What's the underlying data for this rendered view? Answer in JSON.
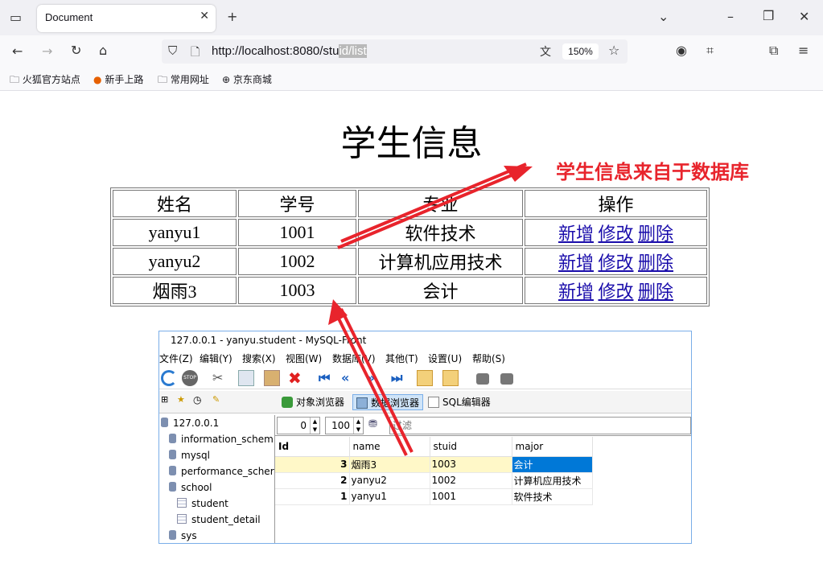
{
  "browser": {
    "tab_title": "Document",
    "url_prefix": "http://localhost:8080/stu",
    "url_selected": "id/list",
    "zoom": "150%",
    "bookmarks": [
      "火狐官方站点",
      "新手上路",
      "常用网址",
      "京东商城"
    ]
  },
  "page": {
    "title": "学生信息",
    "annotation": "学生信息来自于数据库",
    "headers": [
      "姓名",
      "学号",
      "专业",
      "操作"
    ],
    "rows": [
      {
        "name": "yanyu1",
        "id": "1001",
        "major": "软件技术"
      },
      {
        "name": "yanyu2",
        "id": "1002",
        "major": "计算机应用技术"
      },
      {
        "name": "烟雨3",
        "id": "1003",
        "major": "会计"
      }
    ],
    "actions": {
      "add": "新增",
      "edit": "修改",
      "delete": "删除"
    },
    "accent_color": "#e8242c",
    "link_color": "#1a0dab"
  },
  "mysql_front": {
    "title": "127.0.0.1 - yanyu.student - MySQL-Front",
    "menu": [
      "文件(Z)",
      "编辑(Y)",
      "搜索(X)",
      "视图(W)",
      "数据库(V)",
      "其他(T)",
      "设置(U)",
      "帮助(S)"
    ],
    "tabs": [
      "对象浏览器",
      "数据浏览器",
      "SQL编辑器"
    ],
    "tree": [
      "127.0.0.1",
      "information_schem",
      "mysql",
      "performance_scher",
      "school",
      "student",
      "student_detail",
      "sys"
    ],
    "offset": "0",
    "limit": "100",
    "filter_placeholder": "过滤",
    "columns": [
      "Id",
      "name",
      "stuid",
      "major"
    ],
    "rows": [
      {
        "Id": "3",
        "name": "烟雨3",
        "stuid": "1003",
        "major": "会计"
      },
      {
        "Id": "2",
        "name": "yanyu2",
        "stuid": "1002",
        "major": "计算机应用技术"
      },
      {
        "Id": "1",
        "name": "yanyu1",
        "stuid": "1001",
        "major": "软件技术"
      }
    ]
  }
}
